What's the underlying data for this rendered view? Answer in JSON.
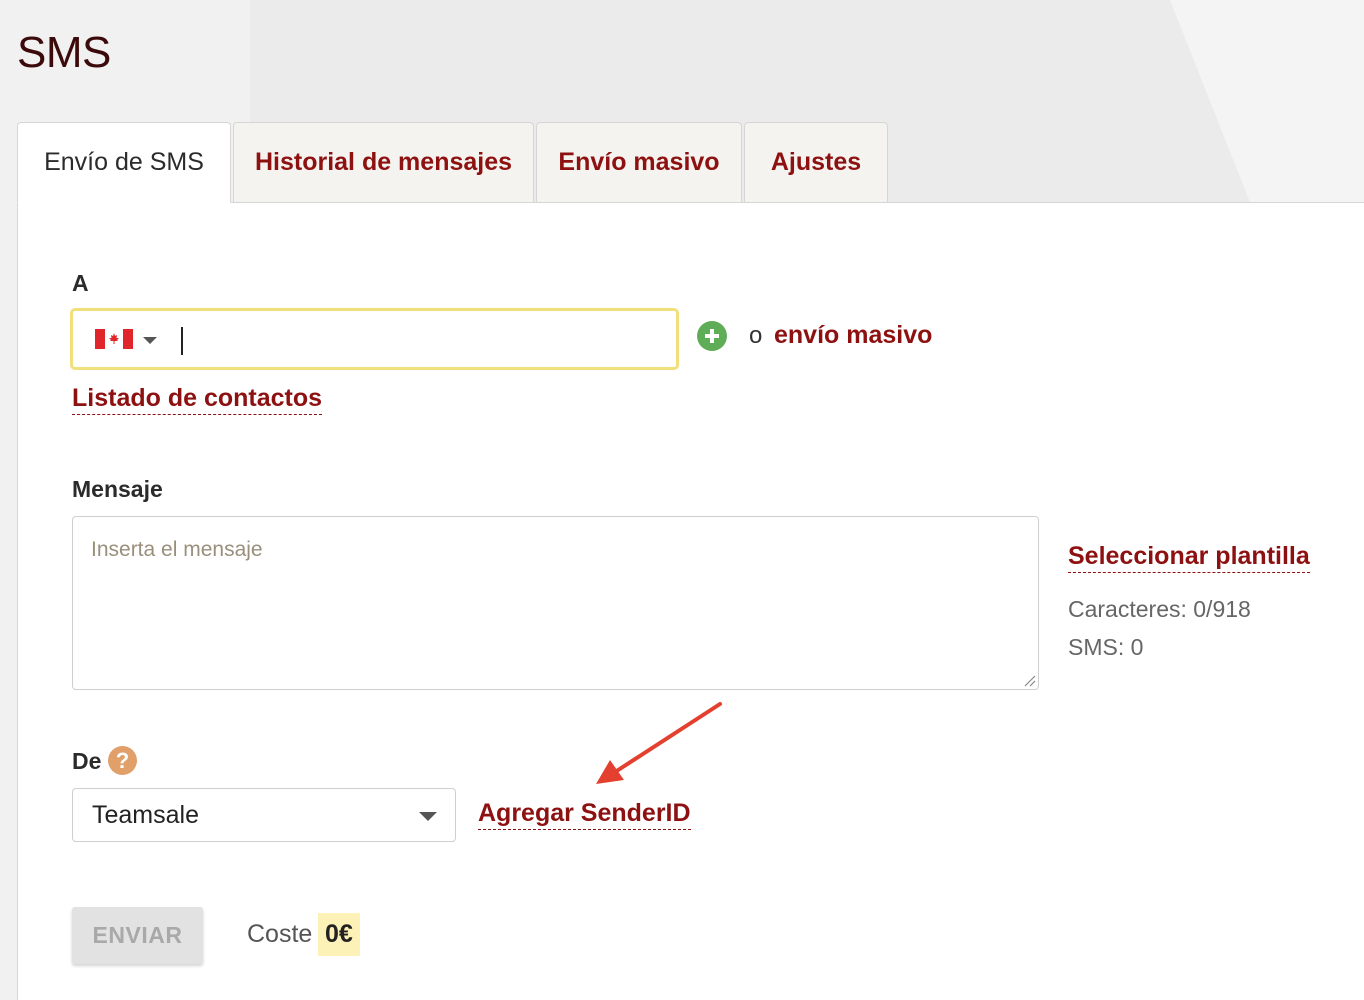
{
  "page": {
    "title": "SMS"
  },
  "tabs": [
    {
      "label": "Envío de SMS",
      "active": true
    },
    {
      "label": "Historial de mensajes",
      "active": false
    },
    {
      "label": "Envío masivo",
      "active": false
    },
    {
      "label": "Ajustes",
      "active": false
    }
  ],
  "to": {
    "label": "A",
    "country_flag": "canada-flag-icon",
    "phone_value": "",
    "or_text": "o",
    "bulk_link": "envío masivo",
    "contacts_link": "Listado de contactos"
  },
  "message": {
    "label": "Mensaje",
    "placeholder": "Inserta el mensaje",
    "template_link": "Seleccionar plantilla",
    "characters": "Caracteres: 0/918",
    "sms_count": "SMS: 0"
  },
  "from": {
    "label": "De",
    "help_icon": "?",
    "selected": "Teamsale",
    "add_sender_link": "Agregar SenderID"
  },
  "footer": {
    "send_label": "ENVIAR",
    "cost_label": "Coste",
    "cost_value": "0€"
  },
  "colors": {
    "accent": "#8e1111",
    "field_focus": "#f1df7c",
    "add_green": "#5fae57",
    "help_orange": "#e19f6a",
    "arrow_red": "#e4402f",
    "cost_highlight": "#fcf2b7"
  }
}
